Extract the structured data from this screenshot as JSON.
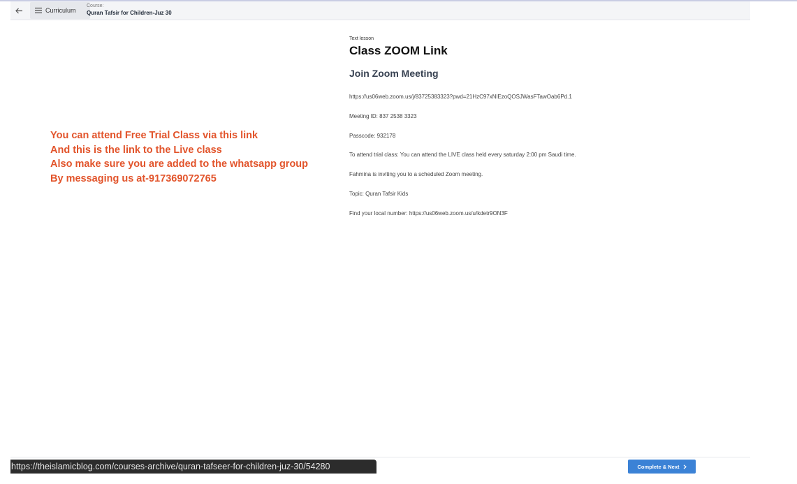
{
  "topbar": {
    "curriculum_label": "Curriculum",
    "course_prefix": "Course:",
    "course_title": "Quran Tafsir for Children-Juz 30"
  },
  "annotation": {
    "lines": [
      "You can attend Free Trial Class via this link",
      "And this is the link to the Live class",
      "Also make sure you are added to the whatsapp group",
      "By messaging us at-917369072765"
    ],
    "color": "#e2542b"
  },
  "lesson": {
    "type": "Text lesson",
    "title": "Class ZOOM Link",
    "section_heading": "Join Zoom Meeting",
    "paragraphs": [
      "https://us06web.zoom.us/j/83725383323?pwd=21HzC97xNlEzoQOSJWasFTawOab6Pd.1",
      "Meeting ID: 837 2538 3323",
      "Passcode: 932178",
      "To attend trial class: You can attend the LIVE class held every saturday 2:00 pm Saudi time.",
      "Fahmina is inviting you to a scheduled Zoom meeting.",
      "Topic: Quran Tafsir Kids",
      "Find your local number: https://us06web.zoom.us/u/kdetr9ON3F"
    ]
  },
  "footer": {
    "status_url": "https://theislamicblog.com/courses-archive/quran-tafseer-for-children-juz-30/54280",
    "complete_label": "Complete & Next",
    "accent": "#3b82d6"
  },
  "icons": {
    "back": "arrow-left-icon",
    "menu": "hamburger-menu-icon",
    "next": "chevron-right-icon"
  }
}
